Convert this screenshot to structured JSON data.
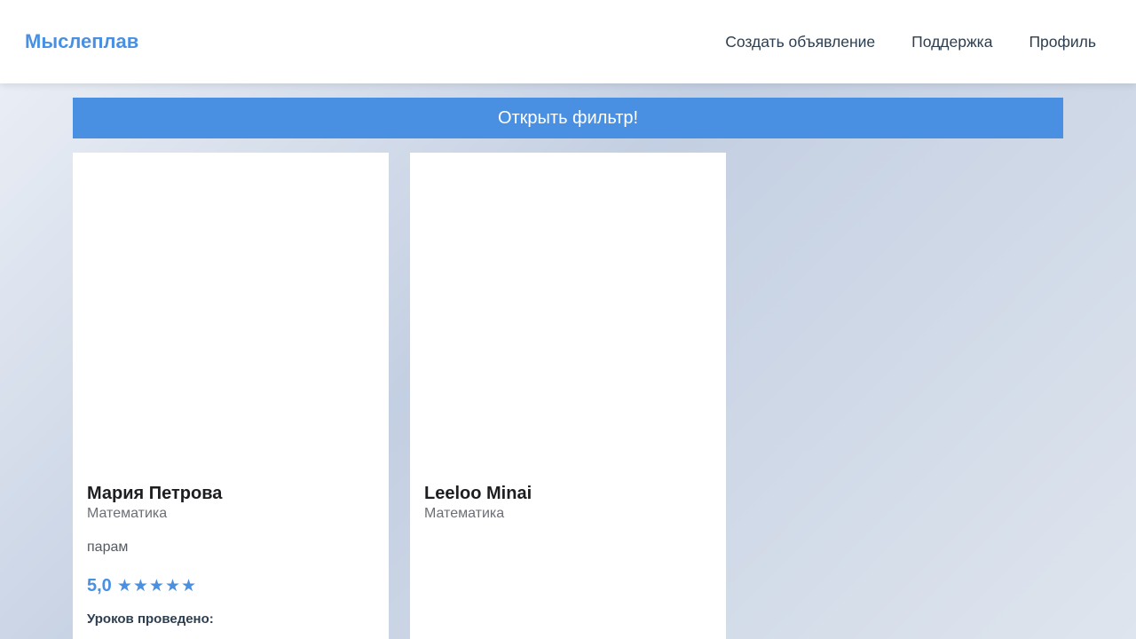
{
  "header": {
    "logo": "Мыслеплав",
    "nav": [
      {
        "label": "Создать объявление"
      },
      {
        "label": "Поддержка"
      },
      {
        "label": "Профиль"
      }
    ]
  },
  "filter": {
    "label": "Открыть фильтр!"
  },
  "cards": [
    {
      "name": "Мария Петрова",
      "subject": "Математика",
      "description": "парам",
      "rating": "5,0",
      "stars": 5,
      "lessons_label": "Уроков проведено:"
    },
    {
      "name": "Leeloo Minai",
      "subject": "Математика"
    }
  ],
  "colors": {
    "accent": "#4a90e2",
    "text_dark": "#1c1e21",
    "text_muted": "#6b6f75"
  }
}
